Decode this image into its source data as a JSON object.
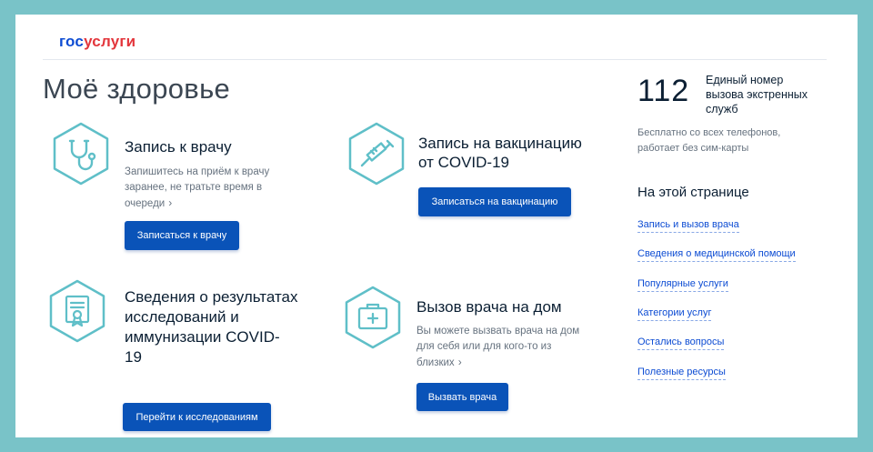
{
  "logo": {
    "part1": "гос",
    "part2": "услуги"
  },
  "page_title": "Моё здоровье",
  "cards": [
    {
      "icon": "stethoscope-icon",
      "title": "Запись к врачу",
      "desc_lines": [
        "Запишитесь на приём к врачу",
        "заранее, не тратьте время в",
        "очереди"
      ],
      "chevron": "›",
      "button": "Записаться к врачу"
    },
    {
      "icon": "syringe-icon",
      "title_lines": [
        "Запись на вакцинацию",
        "от COVID-19"
      ],
      "button": "Записаться на вакцинацию"
    },
    {
      "icon": "certificate-icon",
      "title_lines": [
        "Сведения о результатах",
        "исследований и",
        "иммунизации COVID-",
        "19"
      ],
      "button": "Перейти к исследованиям"
    },
    {
      "icon": "medkit-icon",
      "title": "Вызов врача на дом",
      "desc_lines": [
        "Вы можете вызвать врача на дом",
        "для себя или для кого-то из",
        "близких"
      ],
      "chevron": "›",
      "button": "Вызвать врача"
    }
  ],
  "emergency": {
    "number": "112",
    "label_lines": [
      "Единый номер",
      "вызова экстренных",
      "служб"
    ],
    "note_lines": [
      "Бесплатно со всех телефонов,",
      "работает без сим-карты"
    ]
  },
  "toc": {
    "title": "На этой странице",
    "links": [
      "Запись и вызов врача",
      "Сведения о медицинской помощи",
      "Популярные услуги",
      "Категории услуг",
      "Остались вопросы",
      "Полезные ресурсы"
    ]
  },
  "colors": {
    "accent": "#0a53b8",
    "link": "#0d4cd3",
    "logo_red": "#e3363c",
    "icon_teal": "#5fbfc8",
    "frame": "#79c3c8"
  }
}
